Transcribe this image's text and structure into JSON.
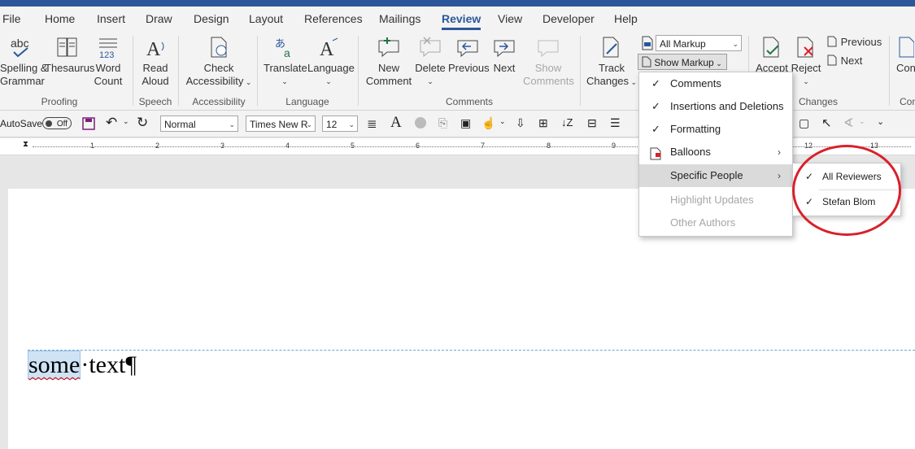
{
  "tabs": [
    "File",
    "Home",
    "Insert",
    "Draw",
    "Design",
    "Layout",
    "References",
    "Mailings",
    "Review",
    "View",
    "Developer",
    "Help"
  ],
  "active_tab": "Review",
  "ribbon": {
    "proofing": {
      "spelling_line1": "Spelling &",
      "spelling_line2": "Grammar",
      "thesaurus": "Thesaurus",
      "wordcount_line1": "Word",
      "wordcount_line2": "Count",
      "group": "Proofing"
    },
    "speech": {
      "read_line1": "Read",
      "read_line2": "Aloud",
      "group": "Speech"
    },
    "accessibility": {
      "check_line1": "Check",
      "check_line2": "Accessibility",
      "group": "Accessibility"
    },
    "language": {
      "translate": "Translate",
      "language": "Language",
      "group": "Language"
    },
    "comments": {
      "new_line1": "New",
      "new_line2": "Comment",
      "delete": "Delete",
      "previous": "Previous",
      "next": "Next",
      "show_line1": "Show",
      "show_line2": "Comments",
      "group": "Comments"
    },
    "tracking": {
      "track_line1": "Track",
      "track_line2": "Changes",
      "markup_value": "All Markup",
      "show_markup": "Show Markup"
    },
    "changes": {
      "accept": "Accept",
      "reject": "Reject",
      "previous": "Previous",
      "next": "Next",
      "group": "Changes"
    },
    "compare": {
      "label": "Con",
      "group": "Com"
    }
  },
  "qat": {
    "autosave": "AutoSave",
    "toggle": "Off",
    "style": "Normal",
    "font": "Times New R",
    "size": "12"
  },
  "ruler_numbers": [
    "1",
    "2",
    "3",
    "4",
    "5",
    "6",
    "7",
    "8",
    "9",
    "12",
    "13"
  ],
  "document": {
    "selected": "some",
    "rest": "·text",
    "pilcrow": "¶"
  },
  "show_markup_menu": {
    "items": [
      {
        "label": "Comments",
        "checked": true
      },
      {
        "label": "Insertions and Deletions",
        "checked": true
      },
      {
        "label": "Formatting",
        "checked": true
      },
      {
        "label": "Balloons",
        "submenu": true
      },
      {
        "label": "Specific People",
        "submenu": true,
        "highlighted": true
      },
      {
        "label": "Highlight Updates",
        "disabled": true
      },
      {
        "label": "Other Authors",
        "disabled": true
      }
    ]
  },
  "specific_people_submenu": {
    "items": [
      {
        "label": "All Reviewers",
        "checked": true
      },
      {
        "label": "Stefan Blom",
        "checked": true
      }
    ]
  },
  "colors": {
    "accent": "#2b579a",
    "annotation": "#d9202a"
  }
}
